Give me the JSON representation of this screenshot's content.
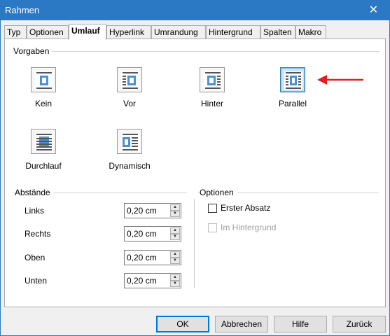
{
  "window": {
    "title": "Rahmen",
    "close_glyph": "✕"
  },
  "tabs": [
    {
      "label": "Typ"
    },
    {
      "label": "Optionen"
    },
    {
      "label": "Umlauf"
    },
    {
      "label": "Hyperlink"
    },
    {
      "label": "Umrandung"
    },
    {
      "label": "Hintergrund"
    },
    {
      "label": "Spalten"
    },
    {
      "label": "Makro"
    }
  ],
  "active_tab": "Umlauf",
  "vorgaben": {
    "label": "Vorgaben",
    "options": [
      {
        "label": "Kein",
        "icon": "wrap-none-icon"
      },
      {
        "label": "Vor",
        "icon": "wrap-before-icon"
      },
      {
        "label": "Hinter",
        "icon": "wrap-after-icon"
      },
      {
        "label": "Parallel",
        "icon": "wrap-parallel-icon",
        "selected": true
      },
      {
        "label": "Durchlauf",
        "icon": "wrap-through-icon"
      },
      {
        "label": "Dynamisch",
        "icon": "wrap-optimal-icon"
      }
    ]
  },
  "abstaende": {
    "label": "Abstände",
    "rows": [
      {
        "label": "Links",
        "value": "0,20 cm"
      },
      {
        "label": "Rechts",
        "value": "0,20 cm"
      },
      {
        "label": "Oben",
        "value": "0,20 cm"
      },
      {
        "label": "Unten",
        "value": "0,20 cm"
      }
    ]
  },
  "optionen": {
    "label": "Optionen",
    "erster_absatz": {
      "label": "Erster Absatz",
      "checked": false,
      "enabled": true
    },
    "im_hintergrund": {
      "label": "Im Hintergrund",
      "checked": false,
      "enabled": false
    }
  },
  "buttons": {
    "ok": "OK",
    "abbrechen": "Abbrechen",
    "hilfe": "Hilfe",
    "zurueck": "Zurück"
  },
  "colors": {
    "titlebar": "#2b78c5",
    "selection": "#cde4f7",
    "annotation_arrow": "#e02020"
  }
}
